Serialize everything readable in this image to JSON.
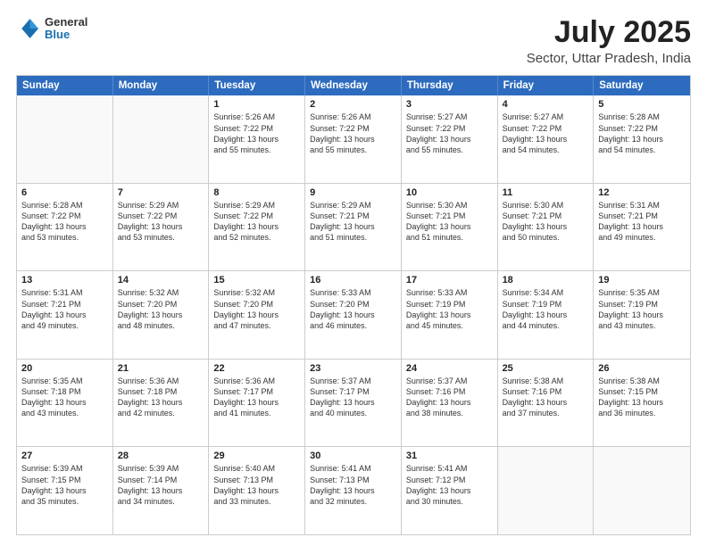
{
  "header": {
    "logo_general": "General",
    "logo_blue": "Blue",
    "main_title": "July 2025",
    "subtitle": "Sector, Uttar Pradesh, India"
  },
  "calendar": {
    "days_of_week": [
      "Sunday",
      "Monday",
      "Tuesday",
      "Wednesday",
      "Thursday",
      "Friday",
      "Saturday"
    ],
    "rows": [
      [
        {
          "day": "",
          "lines": []
        },
        {
          "day": "",
          "lines": []
        },
        {
          "day": "1",
          "lines": [
            "Sunrise: 5:26 AM",
            "Sunset: 7:22 PM",
            "Daylight: 13 hours",
            "and 55 minutes."
          ]
        },
        {
          "day": "2",
          "lines": [
            "Sunrise: 5:26 AM",
            "Sunset: 7:22 PM",
            "Daylight: 13 hours",
            "and 55 minutes."
          ]
        },
        {
          "day": "3",
          "lines": [
            "Sunrise: 5:27 AM",
            "Sunset: 7:22 PM",
            "Daylight: 13 hours",
            "and 55 minutes."
          ]
        },
        {
          "day": "4",
          "lines": [
            "Sunrise: 5:27 AM",
            "Sunset: 7:22 PM",
            "Daylight: 13 hours",
            "and 54 minutes."
          ]
        },
        {
          "day": "5",
          "lines": [
            "Sunrise: 5:28 AM",
            "Sunset: 7:22 PM",
            "Daylight: 13 hours",
            "and 54 minutes."
          ]
        }
      ],
      [
        {
          "day": "6",
          "lines": [
            "Sunrise: 5:28 AM",
            "Sunset: 7:22 PM",
            "Daylight: 13 hours",
            "and 53 minutes."
          ]
        },
        {
          "day": "7",
          "lines": [
            "Sunrise: 5:29 AM",
            "Sunset: 7:22 PM",
            "Daylight: 13 hours",
            "and 53 minutes."
          ]
        },
        {
          "day": "8",
          "lines": [
            "Sunrise: 5:29 AM",
            "Sunset: 7:22 PM",
            "Daylight: 13 hours",
            "and 52 minutes."
          ]
        },
        {
          "day": "9",
          "lines": [
            "Sunrise: 5:29 AM",
            "Sunset: 7:21 PM",
            "Daylight: 13 hours",
            "and 51 minutes."
          ]
        },
        {
          "day": "10",
          "lines": [
            "Sunrise: 5:30 AM",
            "Sunset: 7:21 PM",
            "Daylight: 13 hours",
            "and 51 minutes."
          ]
        },
        {
          "day": "11",
          "lines": [
            "Sunrise: 5:30 AM",
            "Sunset: 7:21 PM",
            "Daylight: 13 hours",
            "and 50 minutes."
          ]
        },
        {
          "day": "12",
          "lines": [
            "Sunrise: 5:31 AM",
            "Sunset: 7:21 PM",
            "Daylight: 13 hours",
            "and 49 minutes."
          ]
        }
      ],
      [
        {
          "day": "13",
          "lines": [
            "Sunrise: 5:31 AM",
            "Sunset: 7:21 PM",
            "Daylight: 13 hours",
            "and 49 minutes."
          ]
        },
        {
          "day": "14",
          "lines": [
            "Sunrise: 5:32 AM",
            "Sunset: 7:20 PM",
            "Daylight: 13 hours",
            "and 48 minutes."
          ]
        },
        {
          "day": "15",
          "lines": [
            "Sunrise: 5:32 AM",
            "Sunset: 7:20 PM",
            "Daylight: 13 hours",
            "and 47 minutes."
          ]
        },
        {
          "day": "16",
          "lines": [
            "Sunrise: 5:33 AM",
            "Sunset: 7:20 PM",
            "Daylight: 13 hours",
            "and 46 minutes."
          ]
        },
        {
          "day": "17",
          "lines": [
            "Sunrise: 5:33 AM",
            "Sunset: 7:19 PM",
            "Daylight: 13 hours",
            "and 45 minutes."
          ]
        },
        {
          "day": "18",
          "lines": [
            "Sunrise: 5:34 AM",
            "Sunset: 7:19 PM",
            "Daylight: 13 hours",
            "and 44 minutes."
          ]
        },
        {
          "day": "19",
          "lines": [
            "Sunrise: 5:35 AM",
            "Sunset: 7:19 PM",
            "Daylight: 13 hours",
            "and 43 minutes."
          ]
        }
      ],
      [
        {
          "day": "20",
          "lines": [
            "Sunrise: 5:35 AM",
            "Sunset: 7:18 PM",
            "Daylight: 13 hours",
            "and 43 minutes."
          ]
        },
        {
          "day": "21",
          "lines": [
            "Sunrise: 5:36 AM",
            "Sunset: 7:18 PM",
            "Daylight: 13 hours",
            "and 42 minutes."
          ]
        },
        {
          "day": "22",
          "lines": [
            "Sunrise: 5:36 AM",
            "Sunset: 7:17 PM",
            "Daylight: 13 hours",
            "and 41 minutes."
          ]
        },
        {
          "day": "23",
          "lines": [
            "Sunrise: 5:37 AM",
            "Sunset: 7:17 PM",
            "Daylight: 13 hours",
            "and 40 minutes."
          ]
        },
        {
          "day": "24",
          "lines": [
            "Sunrise: 5:37 AM",
            "Sunset: 7:16 PM",
            "Daylight: 13 hours",
            "and 38 minutes."
          ]
        },
        {
          "day": "25",
          "lines": [
            "Sunrise: 5:38 AM",
            "Sunset: 7:16 PM",
            "Daylight: 13 hours",
            "and 37 minutes."
          ]
        },
        {
          "day": "26",
          "lines": [
            "Sunrise: 5:38 AM",
            "Sunset: 7:15 PM",
            "Daylight: 13 hours",
            "and 36 minutes."
          ]
        }
      ],
      [
        {
          "day": "27",
          "lines": [
            "Sunrise: 5:39 AM",
            "Sunset: 7:15 PM",
            "Daylight: 13 hours",
            "and 35 minutes."
          ]
        },
        {
          "day": "28",
          "lines": [
            "Sunrise: 5:39 AM",
            "Sunset: 7:14 PM",
            "Daylight: 13 hours",
            "and 34 minutes."
          ]
        },
        {
          "day": "29",
          "lines": [
            "Sunrise: 5:40 AM",
            "Sunset: 7:13 PM",
            "Daylight: 13 hours",
            "and 33 minutes."
          ]
        },
        {
          "day": "30",
          "lines": [
            "Sunrise: 5:41 AM",
            "Sunset: 7:13 PM",
            "Daylight: 13 hours",
            "and 32 minutes."
          ]
        },
        {
          "day": "31",
          "lines": [
            "Sunrise: 5:41 AM",
            "Sunset: 7:12 PM",
            "Daylight: 13 hours",
            "and 30 minutes."
          ]
        },
        {
          "day": "",
          "lines": []
        },
        {
          "day": "",
          "lines": []
        }
      ]
    ]
  }
}
